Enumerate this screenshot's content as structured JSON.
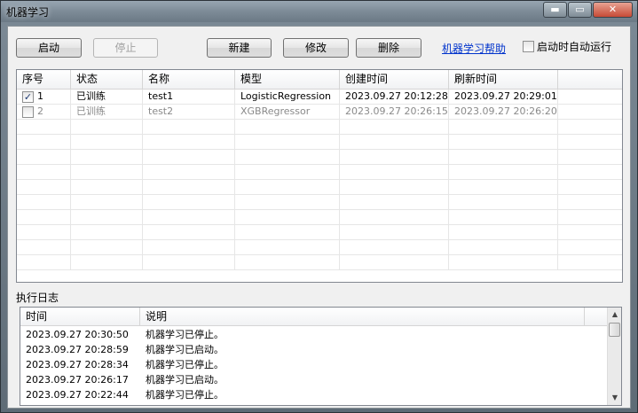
{
  "window": {
    "title": "机器学习",
    "min_glyph": "▬",
    "max_glyph": "▭",
    "close_glyph": "✕"
  },
  "toolbar": {
    "start_label": "启动",
    "stop_label": "停止",
    "new_label": "新建",
    "edit_label": "修改",
    "delete_label": "删除",
    "help_link": "机器学习帮助",
    "autorun_label": "启动时自动运行",
    "autorun_checked": false
  },
  "models_table": {
    "columns": [
      "序号",
      "状态",
      "名称",
      "模型",
      "创建时间",
      "刷新时间"
    ],
    "rows": [
      {
        "checked": true,
        "index": "1",
        "status": "已训练",
        "name": "test1",
        "model": "LogisticRegression",
        "created": "2023.09.27 20:12:28",
        "refreshed": "2023.09.27 20:29:01"
      },
      {
        "checked": false,
        "index": "2",
        "status": "已训练",
        "name": "test2",
        "model": "XGBRegressor",
        "created": "2023.09.27 20:26:15",
        "refreshed": "2023.09.27 20:26:20"
      }
    ]
  },
  "log": {
    "title": "执行日志",
    "columns": [
      "时间",
      "说明"
    ],
    "rows": [
      {
        "time": "2023.09.27 20:30:50",
        "desc": "机器学习已停止。"
      },
      {
        "time": "2023.09.27 20:28:59",
        "desc": "机器学习已启动。"
      },
      {
        "time": "2023.09.27 20:28:34",
        "desc": "机器学习已停止。"
      },
      {
        "time": "2023.09.27 20:26:17",
        "desc": "机器学习已启动。"
      },
      {
        "time": "2023.09.27 20:22:44",
        "desc": "机器学习已停止。"
      }
    ]
  },
  "icons": {
    "scroll_up": "▲",
    "scroll_down": "▼",
    "check": "✓"
  }
}
